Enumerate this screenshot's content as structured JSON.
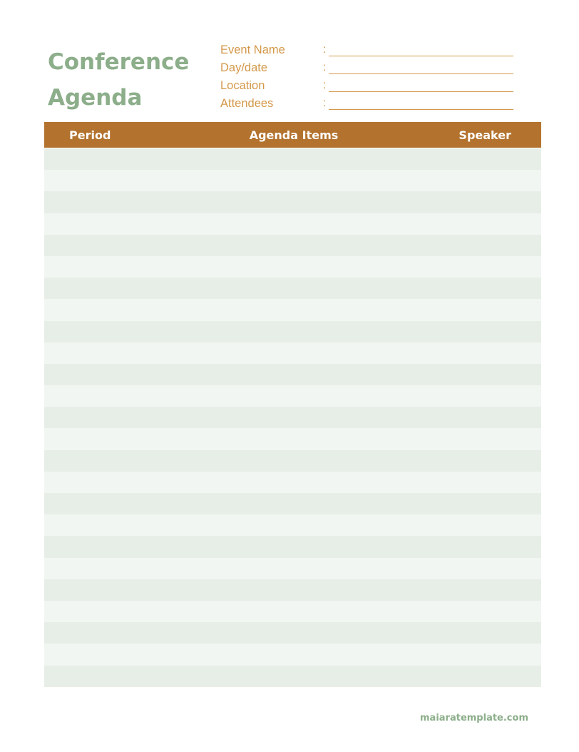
{
  "document": {
    "title_line1": "Conference",
    "title_line2": "Agenda",
    "fields": [
      {
        "label": "Event Name",
        "separator": ":",
        "value": ""
      },
      {
        "label": "Day/date",
        "separator": ":",
        "value": ""
      },
      {
        "label": "Location",
        "separator": ":",
        "value": ""
      },
      {
        "label": "Attendees",
        "separator": ":",
        "value": ""
      }
    ],
    "table": {
      "headers": {
        "period": "Period",
        "agenda": "Agenda Items",
        "speaker": "Speaker"
      },
      "row_count": 25,
      "rows": []
    },
    "footer": "maiaratemplate.com"
  },
  "colors": {
    "title_green": "#8cae8a",
    "field_orange": "#d4984a",
    "header_brown": "#b3732f",
    "row_dark": "#e7eee7",
    "row_light": "#f1f6f2"
  }
}
